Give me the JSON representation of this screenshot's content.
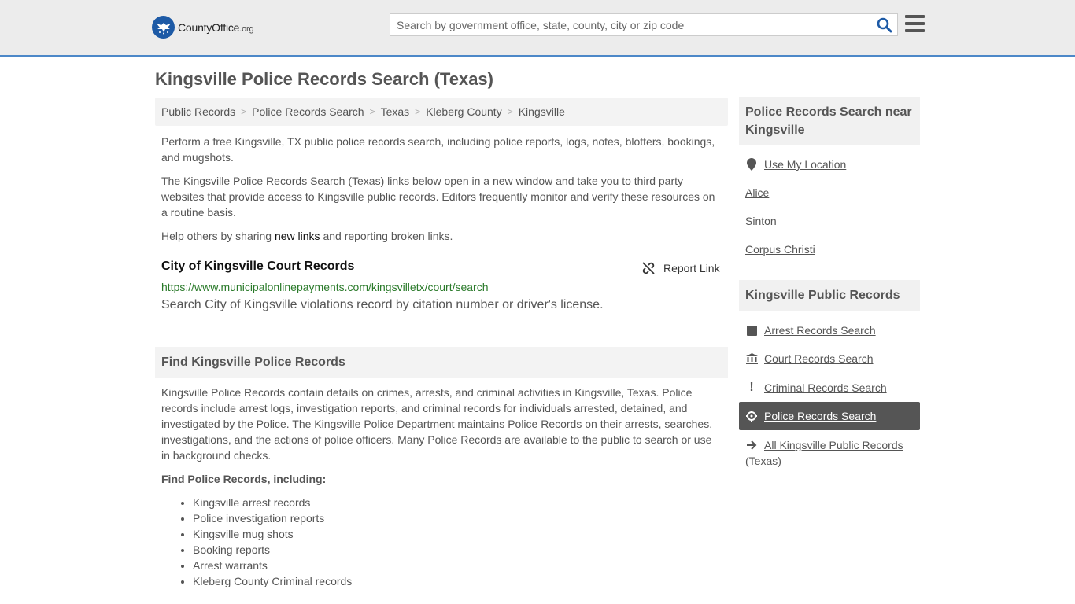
{
  "header": {
    "logo_text": "CountyOffice",
    "logo_suffix": ".org",
    "search_placeholder": "Search by government office, state, county, city or zip code"
  },
  "page_title": "Kingsville Police Records Search (Texas)",
  "breadcrumb": [
    "Public Records",
    "Police Records Search",
    "Texas",
    "Kleberg County",
    "Kingsville"
  ],
  "intro": {
    "p1": "Perform a free Kingsville, TX public police records search, including police reports, logs, notes, blotters, bookings, and mugshots.",
    "p2": "The Kingsville Police Records Search (Texas) links below open in a new window and take you to third party websites that provide access to Kingsville public records. Editors frequently monitor and verify these resources on a routine basis.",
    "p3_before": "Help others by sharing ",
    "p3_link": "new links",
    "p3_after": " and reporting broken links."
  },
  "result": {
    "title": "City of Kingsville Court Records",
    "report_label": "Report Link",
    "url": "https://www.municipalonlinepayments.com/kingsvilletx/court/search",
    "description": "Search City of Kingsville violations record by citation number or driver's license."
  },
  "find_section": {
    "heading": "Find Kingsville Police Records",
    "body": "Kingsville Police Records contain details on crimes, arrests, and criminal activities in Kingsville, Texas. Police records include arrest logs, investigation reports, and criminal records for individuals arrested, detained, and investigated by the Police. The Kingsville Police Department maintains Police Records on their arrests, searches, investigations, and the actions of police officers. Many Police Records are available to the public to search or use in background checks.",
    "subheading": "Find Police Records, including:",
    "items": [
      "Kingsville arrest records",
      "Police investigation reports",
      "Kingsville mug shots",
      "Booking reports",
      "Arrest warrants",
      "Kleberg County Criminal records"
    ]
  },
  "sidebar": {
    "near_heading": "Police Records Search near Kingsville",
    "use_location": "Use My Location",
    "nearby": [
      "Alice",
      "Sinton",
      "Corpus Christi"
    ],
    "records_heading": "Kingsville Public Records",
    "records_links": [
      {
        "label": "Arrest Records Search",
        "icon": "square-icon"
      },
      {
        "label": "Court Records Search",
        "icon": "courthouse-icon"
      },
      {
        "label": "Criminal Records Search",
        "icon": "exclamation-icon"
      },
      {
        "label": "Police Records Search",
        "icon": "crosshair-icon",
        "active": true
      },
      {
        "label": "All Kingsville Public Records (Texas)",
        "icon": "arrow-right-icon"
      }
    ]
  },
  "colors": {
    "accent": "#4c88c8",
    "logo_blue": "#1d5aa6",
    "url_green": "#2a7a2a",
    "active_bg": "#555555"
  }
}
